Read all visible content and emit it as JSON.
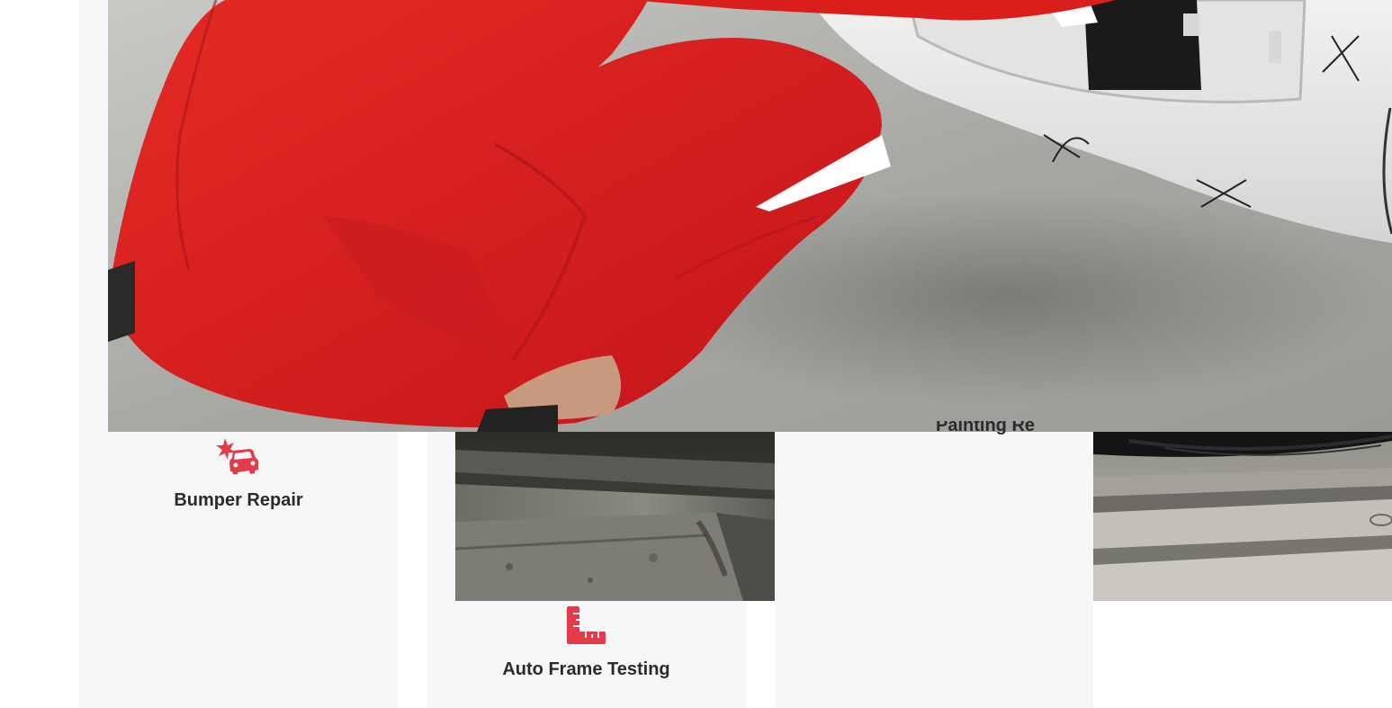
{
  "services": [
    {
      "title": "Bumper Repair",
      "icon": "car-crash-icon"
    },
    {
      "title": "Auto Frame Testing",
      "icon": "ruler-combined-icon"
    },
    {
      "title": "Painting Repair",
      "icon": ""
    },
    {
      "title": "",
      "icon": ""
    }
  ],
  "hero": {
    "image": "mechanic-in-red-coveralls-repairing-white-car-bumper"
  },
  "colors": {
    "accent": "#e53b48",
    "card_bg": "#f6f7f9",
    "title_text": "#2b2b2b",
    "coverall_red": "#d81f1f",
    "floor_gray": "#a9a9a6"
  }
}
